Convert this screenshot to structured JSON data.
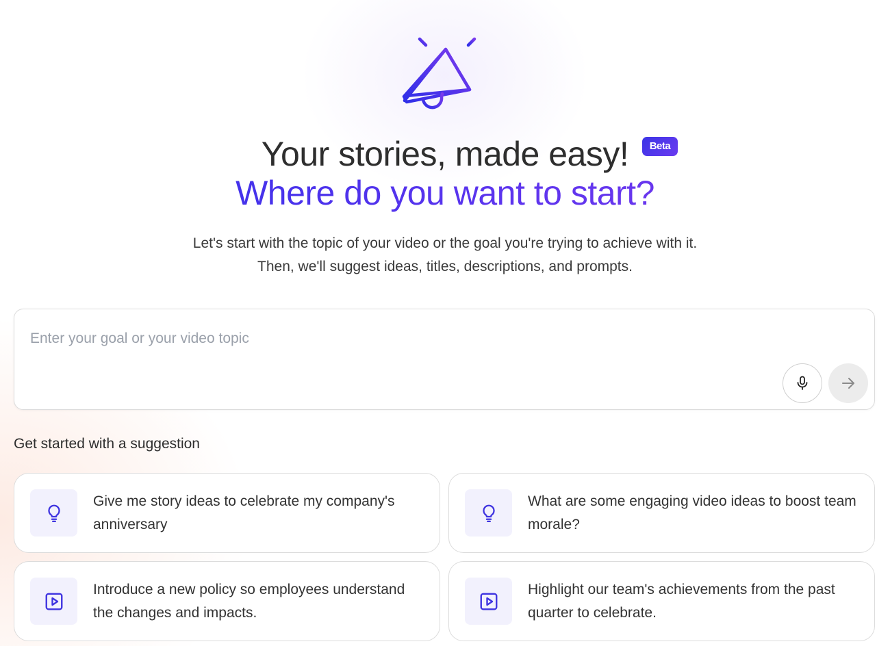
{
  "hero": {
    "icon": "megaphone-icon",
    "title": "Your stories, made easy!",
    "badge": "Beta",
    "subtitle": "Where do you want to start?",
    "intro_line1": "Let's start with the topic of your video or the goal you're trying to achieve with it.",
    "intro_line2": "Then, we'll suggest ideas, titles, descriptions, and prompts."
  },
  "prompt": {
    "placeholder": "Enter your goal or your video topic",
    "value": "",
    "mic_icon": "microphone-icon",
    "send_icon": "arrow-right-icon"
  },
  "suggestions": {
    "heading": "Get started with a suggestion",
    "items": [
      {
        "icon": "lightbulb-icon",
        "text": "Give me story ideas to celebrate my company's anniversary"
      },
      {
        "icon": "lightbulb-icon",
        "text": "What are some engaging video ideas to boost team morale?"
      },
      {
        "icon": "play-icon",
        "text": "Introduce a new policy so employees understand the changes and impacts."
      },
      {
        "icon": "play-icon",
        "text": "Highlight our team's achievements from the past quarter to celebrate."
      }
    ]
  },
  "colors": {
    "accent": "#4f35e8",
    "accent_purple": "#7c3aed",
    "icon_bg": "#f2f1fd"
  }
}
